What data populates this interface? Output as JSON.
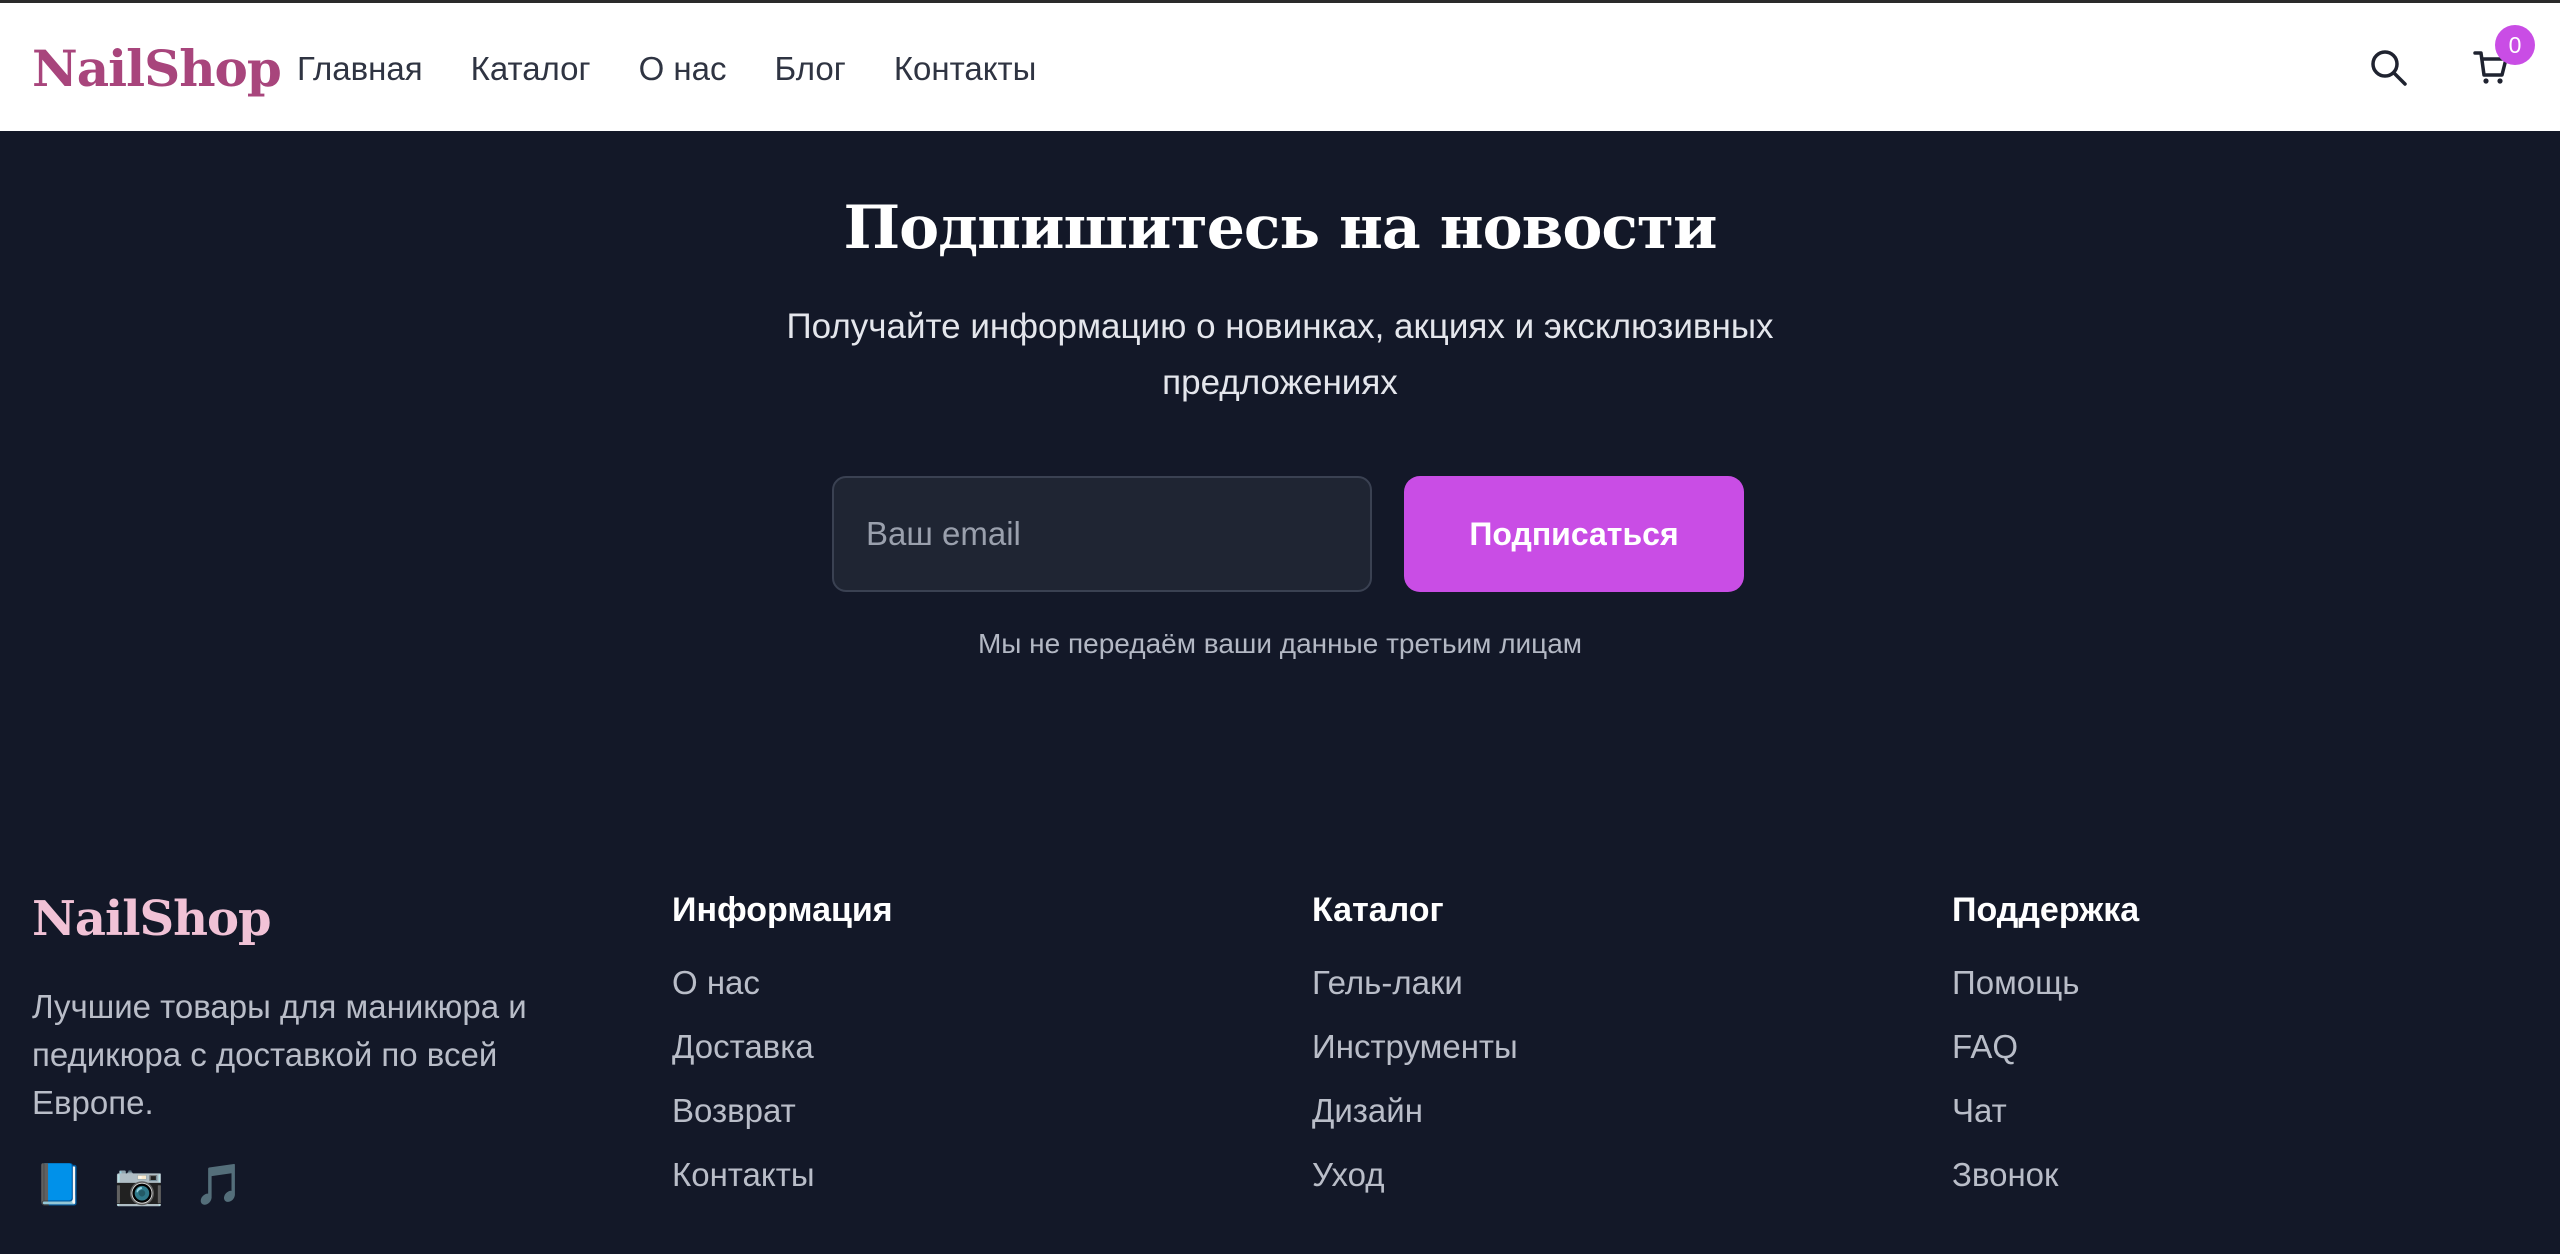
{
  "header": {
    "brand": "NailShop",
    "nav": [
      "Главная",
      "Каталог",
      "О нас",
      "Блог",
      "Контакты"
    ],
    "cart_count": "0",
    "icons": [
      "search-icon",
      "cart-icon"
    ]
  },
  "newsletter": {
    "title": "Подпишитесь на новости",
    "subtitle": "Получайте информацию о новинках, акциях и эксклюзивных предложениях",
    "email_placeholder": "Ваш email",
    "subscribe_label": "Подписаться",
    "privacy_note": "Мы не передаём ваши данные третьим лицам"
  },
  "footer": {
    "brand": "NailShop",
    "description": "Лучшие товары для маникюра и педикюра с доставкой по всей Европе.",
    "socials": [
      "📘",
      "📷",
      "🎵"
    ],
    "columns": [
      {
        "title": "Информация",
        "links": [
          "О нас",
          "Доставка",
          "Возврат",
          "Контакты"
        ]
      },
      {
        "title": "Каталог",
        "links": [
          "Гель-лаки",
          "Инструменты",
          "Дизайн",
          "Уход"
        ]
      },
      {
        "title": "Поддержка",
        "links": [
          "Помощь",
          "FAQ",
          "Чат",
          "Звонок"
        ]
      }
    ]
  },
  "colors": {
    "accent": "#c94de5",
    "brand": "#a8457c",
    "footer_brand": "#f1c2d6",
    "background_dark": "#131828",
    "header_bg": "#ffffff"
  }
}
